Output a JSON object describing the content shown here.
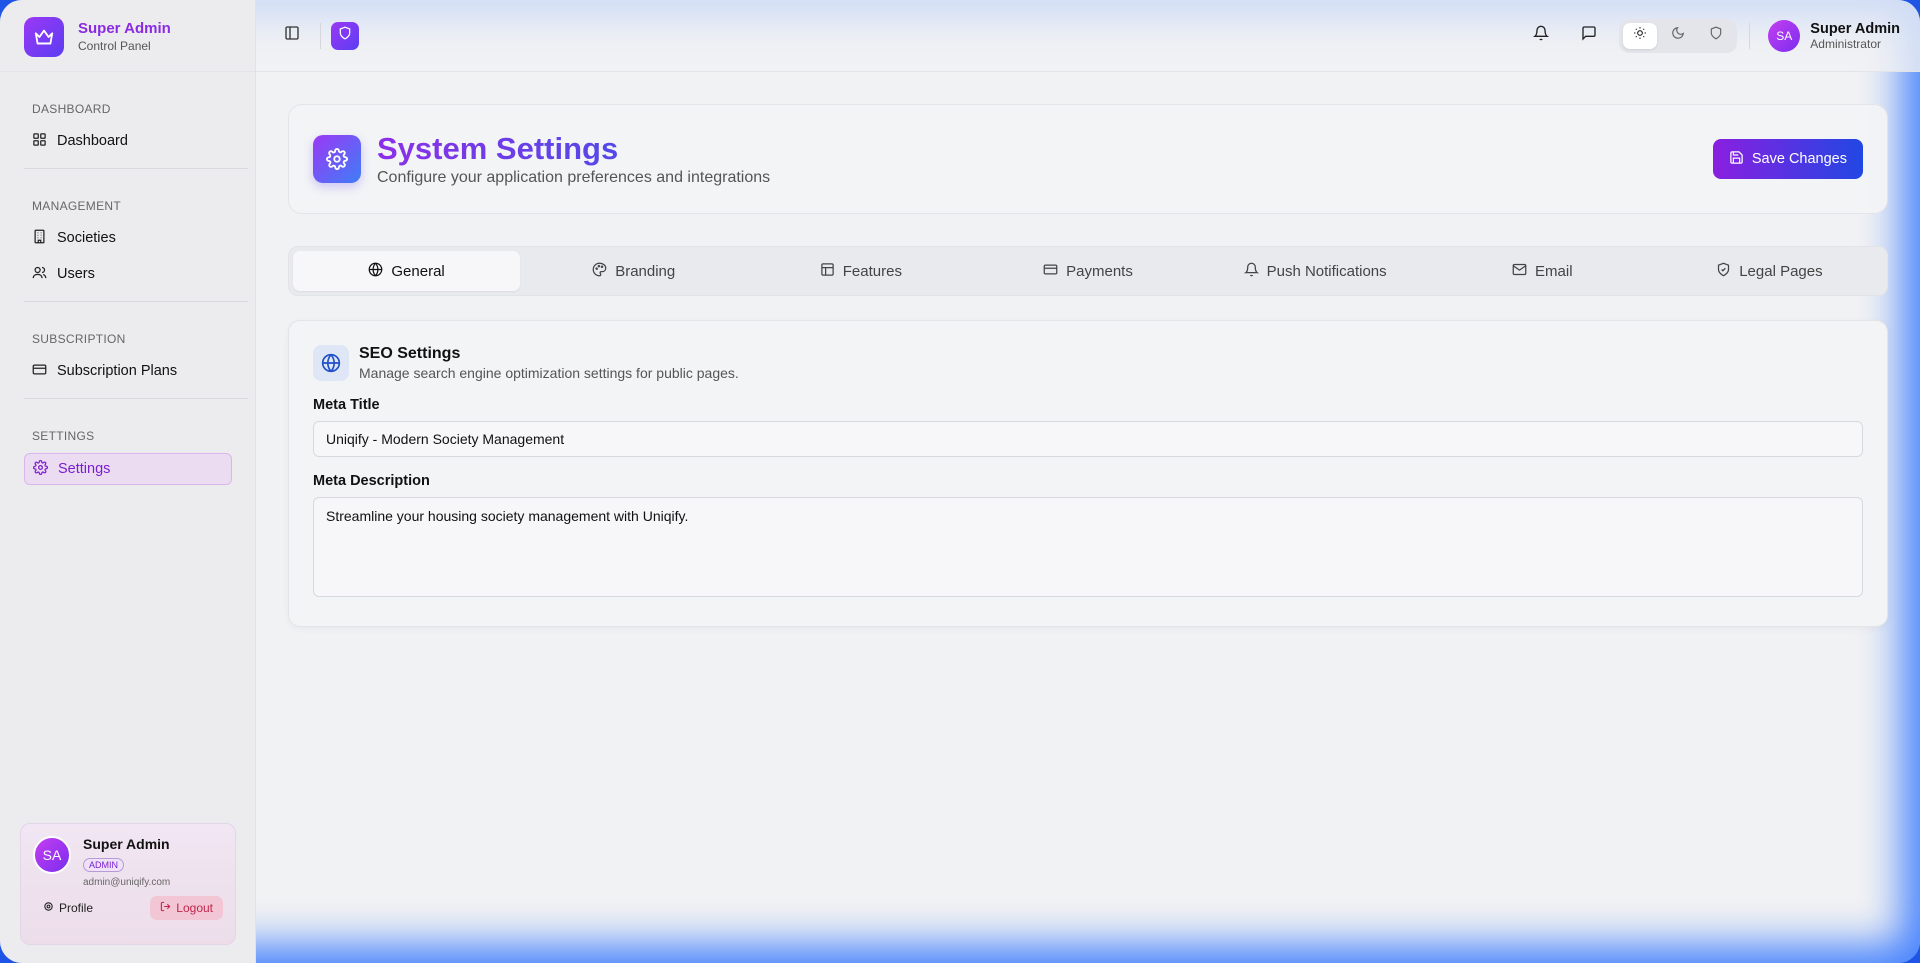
{
  "brand": {
    "title": "Super Admin",
    "subtitle": "Control Panel"
  },
  "sidebar": {
    "sections": [
      {
        "label": "DASHBOARD",
        "items": [
          {
            "label": "Dashboard",
            "icon": "grid-icon"
          }
        ]
      },
      {
        "label": "MANAGEMENT",
        "items": [
          {
            "label": "Societies",
            "icon": "building-icon"
          },
          {
            "label": "Users",
            "icon": "users-icon"
          }
        ]
      },
      {
        "label": "SUBSCRIPTION",
        "items": [
          {
            "label": "Subscription Plans",
            "icon": "credit-card-icon"
          }
        ]
      },
      {
        "label": "SETTINGS",
        "items": [
          {
            "label": "Settings",
            "icon": "gear-icon",
            "active": true
          }
        ]
      }
    ]
  },
  "user_card": {
    "initials": "SA",
    "name": "Super Admin",
    "badge": "ADMIN",
    "email": "admin@uniqify.com",
    "profile_label": "Profile",
    "logout_label": "Logout"
  },
  "topbar": {
    "user_initials": "SA",
    "user_name": "Super Admin",
    "user_role": "Administrator"
  },
  "header": {
    "title": "System Settings",
    "subtitle": "Configure your application preferences and integrations",
    "save_label": "Save Changes"
  },
  "tabs": [
    {
      "label": "General",
      "icon": "globe-icon",
      "active": true
    },
    {
      "label": "Branding",
      "icon": "palette-icon"
    },
    {
      "label": "Features",
      "icon": "layout-icon"
    },
    {
      "label": "Payments",
      "icon": "credit-card-icon"
    },
    {
      "label": "Push Notifications",
      "icon": "bell-icon"
    },
    {
      "label": "Email",
      "icon": "mail-icon"
    },
    {
      "label": "Legal Pages",
      "icon": "shield-check-icon"
    }
  ],
  "seo": {
    "title": "SEO Settings",
    "subtitle": "Manage search engine optimization settings for public pages.",
    "meta_title_label": "Meta Title",
    "meta_title_value": "Uniqify - Modern Society Management",
    "meta_description_label": "Meta Description",
    "meta_description_value": "Streamline your housing society management with Uniqify."
  },
  "colors": {
    "accent_purple": "#8a2be2",
    "accent_blue": "#2147e3",
    "logout_red": "#c0264b"
  }
}
